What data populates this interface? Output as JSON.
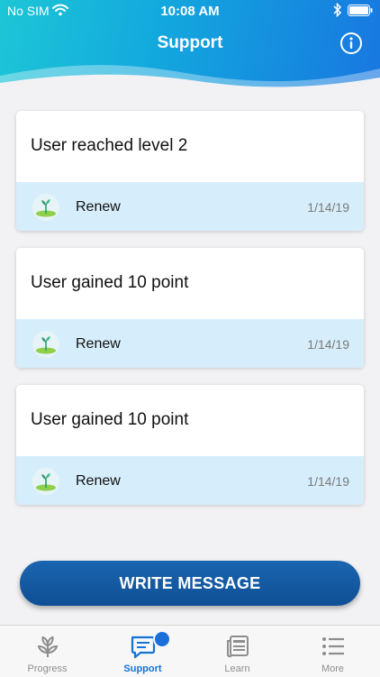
{
  "status_bar": {
    "carrier": "No SIM",
    "time": "10:08 AM"
  },
  "header": {
    "title": "Support",
    "info_icon": "info-icon"
  },
  "cards": [
    {
      "title": "User reached level 2",
      "app": "Renew",
      "date": "1/14/19",
      "icon": "sprout-icon"
    },
    {
      "title": "User gained 10 point",
      "app": "Renew",
      "date": "1/14/19",
      "icon": "sprout-icon"
    },
    {
      "title": "User gained 10 point",
      "app": "Renew",
      "date": "1/14/19",
      "icon": "sprout-icon"
    }
  ],
  "write_button": {
    "label": "WRITE MESSAGE"
  },
  "tabbar": {
    "tabs": [
      {
        "label": "Progress",
        "icon": "sprout-outline-icon",
        "active": false
      },
      {
        "label": "Support",
        "icon": "chat-icon",
        "active": true,
        "badge": true
      },
      {
        "label": "Learn",
        "icon": "news-icon",
        "active": false
      },
      {
        "label": "More",
        "icon": "list-icon",
        "active": false
      }
    ]
  },
  "colors": {
    "header_start": "#1dc6d6",
    "header_end": "#1877e0",
    "card_footer": "#d6eefb",
    "button": "#1a65b0",
    "active_tab": "#1473d6"
  }
}
